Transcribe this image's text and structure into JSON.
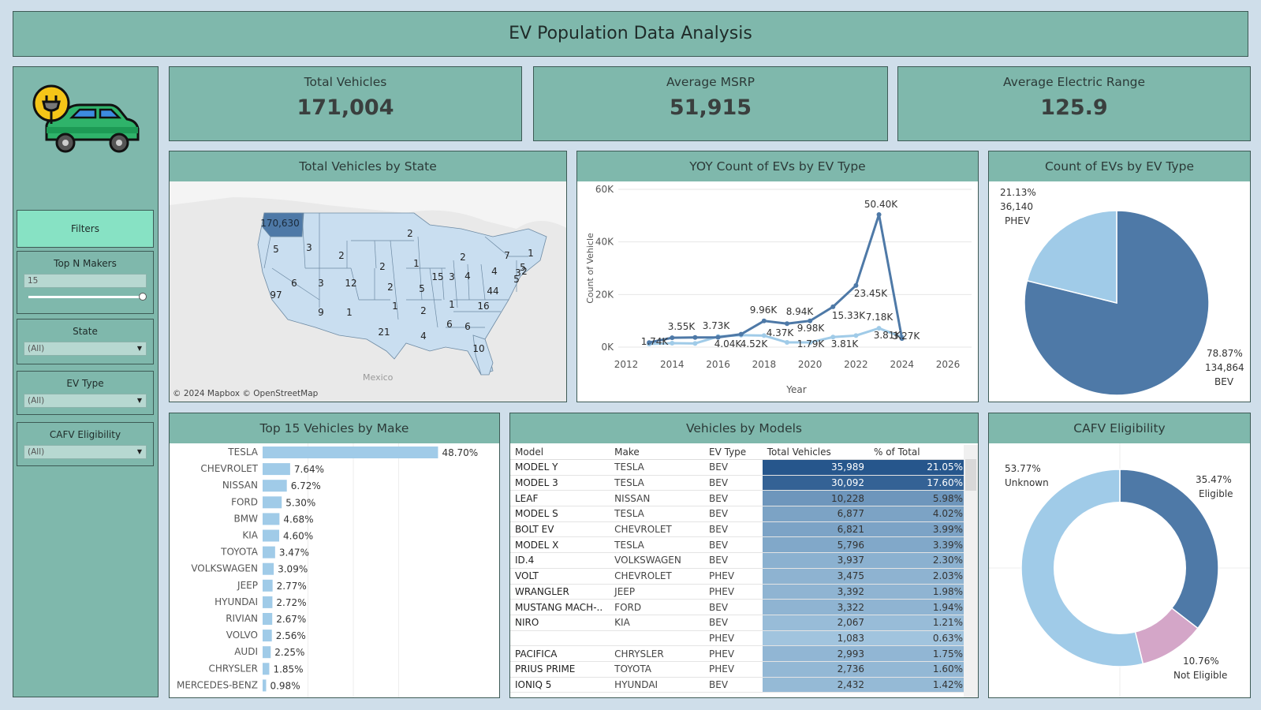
{
  "title": "EV Population Data Analysis",
  "kpis": [
    {
      "label": "Total Vehicles",
      "value": "171,004"
    },
    {
      "label": "Average MSRP",
      "value": "51,915"
    },
    {
      "label": "Average Electric Range",
      "value": "125.9"
    }
  ],
  "sidebar": {
    "filters_label": "Filters",
    "top_n": {
      "label": "Top N Makers",
      "value": "15",
      "slider_fraction": 1.0
    },
    "state": {
      "label": "State",
      "value": "(All)"
    },
    "ev_type": {
      "label": "EV Type",
      "value": "(All)"
    },
    "cafv": {
      "label": "CAFV Eligibility",
      "value": "(All)"
    }
  },
  "map": {
    "title": "Total Vehicles by State",
    "attribution": "© 2024 Mapbox  © OpenStreetMap",
    "mexico_label": "Mexico",
    "labels": [
      "170,630",
      "5",
      "3",
      "2",
      "2",
      "97",
      "6",
      "3",
      "12",
      "2",
      "9",
      "1",
      "1",
      "21",
      "2",
      "1",
      "5",
      "15",
      "3",
      "4",
      "2",
      "2",
      "7",
      "4",
      "44",
      "5",
      "3",
      "16",
      "6",
      "6",
      "10",
      "4",
      "1",
      "5",
      "2",
      "1"
    ],
    "colors": {
      "highlight": "#4e79a7",
      "state": "#c9def0"
    }
  },
  "line_chart": {
    "title": "YOY Count of EVs by EV Type",
    "xlabel": "Year",
    "ylabel": "Count of Vehicle",
    "chart_data": {
      "type": "line",
      "x": [
        2013,
        2014,
        2015,
        2016,
        2017,
        2018,
        2019,
        2020,
        2021,
        2022,
        2023,
        2024
      ],
      "xlim": [
        2012,
        2026
      ],
      "xticks": [
        2012,
        2014,
        2016,
        2018,
        2020,
        2022,
        2024,
        2026
      ],
      "ylim": [
        0,
        60000
      ],
      "yticks": [
        "0K",
        "20K",
        "40K",
        "60K"
      ],
      "series": [
        {
          "name": "BEV",
          "color": "#4e79a7",
          "values": [
            1740,
            3550,
            3670,
            3730,
            4900,
            9960,
            8940,
            9980,
            15330,
            23450,
            50400,
            3270
          ]
        },
        {
          "name": "PHEV",
          "color": "#a0cbe8",
          "values": [
            1200,
            1500,
            1400,
            4040,
            4520,
            4370,
            1790,
            1790,
            3810,
            4400,
            7180,
            3810
          ]
        }
      ]
    },
    "data_labels": [
      "1.74K",
      "3.55K",
      "3.73K",
      "4.04K",
      "4.52K",
      "9.96K",
      "4.37K",
      "8.94K",
      "9.98K",
      "1.79K",
      "15.33K",
      "3.81K",
      "23.45K",
      "7.18K",
      "50.40K",
      "3.81K",
      "3.27K"
    ]
  },
  "pie": {
    "title": "Count of EVs by EV Type",
    "chart_data": {
      "type": "pie",
      "slices": [
        {
          "name": "BEV",
          "value": 134864,
          "percent": "78.87%",
          "count": "134,864",
          "color": "#4e79a7"
        },
        {
          "name": "PHEV",
          "value": 36140,
          "percent": "21.13%",
          "count": "36,140",
          "color": "#a0cbe8"
        }
      ]
    }
  },
  "bars": {
    "title": "Top 15 Vehicles by Make",
    "chart_data": {
      "type": "bar",
      "categories": [
        "TESLA",
        "CHEVROLET",
        "NISSAN",
        "FORD",
        "BMW",
        "KIA",
        "TOYOTA",
        "VOLKSWAGEN",
        "JEEP",
        "HYUNDAI",
        "RIVIAN",
        "VOLVO",
        "AUDI",
        "CHRYSLER",
        "MERCEDES-BENZ"
      ],
      "values": [
        48.7,
        7.64,
        6.72,
        5.3,
        4.68,
        4.6,
        3.47,
        3.09,
        2.77,
        2.72,
        2.67,
        2.56,
        2.25,
        1.85,
        0.98
      ],
      "labels": [
        "48.70%",
        "7.64%",
        "6.72%",
        "5.30%",
        "4.68%",
        "4.60%",
        "3.47%",
        "3.09%",
        "2.77%",
        "2.72%",
        "2.67%",
        "2.56%",
        "2.25%",
        "1.85%",
        "0.98%"
      ],
      "color": "#a0cbe8"
    }
  },
  "models": {
    "title": "Vehicles by Models",
    "columns": [
      "Model",
      "Make",
      "EV Type",
      "Total Vehicles",
      "% of Total"
    ],
    "rows": [
      [
        "MODEL Y",
        "TESLA",
        "BEV",
        "35,989",
        "21.05%"
      ],
      [
        "MODEL 3",
        "TESLA",
        "BEV",
        "30,092",
        "17.60%"
      ],
      [
        "LEAF",
        "NISSAN",
        "BEV",
        "10,228",
        "5.98%"
      ],
      [
        "MODEL S",
        "TESLA",
        "BEV",
        "6,877",
        "4.02%"
      ],
      [
        "BOLT EV",
        "CHEVROLET",
        "BEV",
        "6,821",
        "3.99%"
      ],
      [
        "MODEL X",
        "TESLA",
        "BEV",
        "5,796",
        "3.39%"
      ],
      [
        "ID.4",
        "VOLKSWAGEN",
        "BEV",
        "3,937",
        "2.30%"
      ],
      [
        "VOLT",
        "CHEVROLET",
        "PHEV",
        "3,475",
        "2.03%"
      ],
      [
        "WRANGLER",
        "JEEP",
        "PHEV",
        "3,392",
        "1.98%"
      ],
      [
        "MUSTANG MACH-..",
        "FORD",
        "BEV",
        "3,322",
        "1.94%"
      ],
      [
        "NIRO",
        "KIA",
        "BEV",
        "2,067",
        "1.21%"
      ],
      [
        "",
        "",
        "PHEV",
        "1,083",
        "0.63%"
      ],
      [
        "PACIFICA",
        "CHRYSLER",
        "PHEV",
        "2,993",
        "1.75%"
      ],
      [
        "PRIUS PRIME",
        "TOYOTA",
        "PHEV",
        "2,736",
        "1.60%"
      ],
      [
        "IONIQ 5",
        "HYUNDAI",
        "BEV",
        "2,432",
        "1.42%"
      ]
    ]
  },
  "donut": {
    "title": "CAFV Eligibility",
    "chart_data": {
      "type": "pie",
      "slices": [
        {
          "name": "Eligible",
          "value": 35.47,
          "percent": "35.47%",
          "color": "#4e79a7"
        },
        {
          "name": "Not Eligible",
          "value": 10.76,
          "percent": "10.76%",
          "color": "#d4a6c8"
        },
        {
          "name": "Unknown",
          "value": 53.77,
          "percent": "53.77%",
          "color": "#a0cbe8"
        }
      ]
    }
  }
}
